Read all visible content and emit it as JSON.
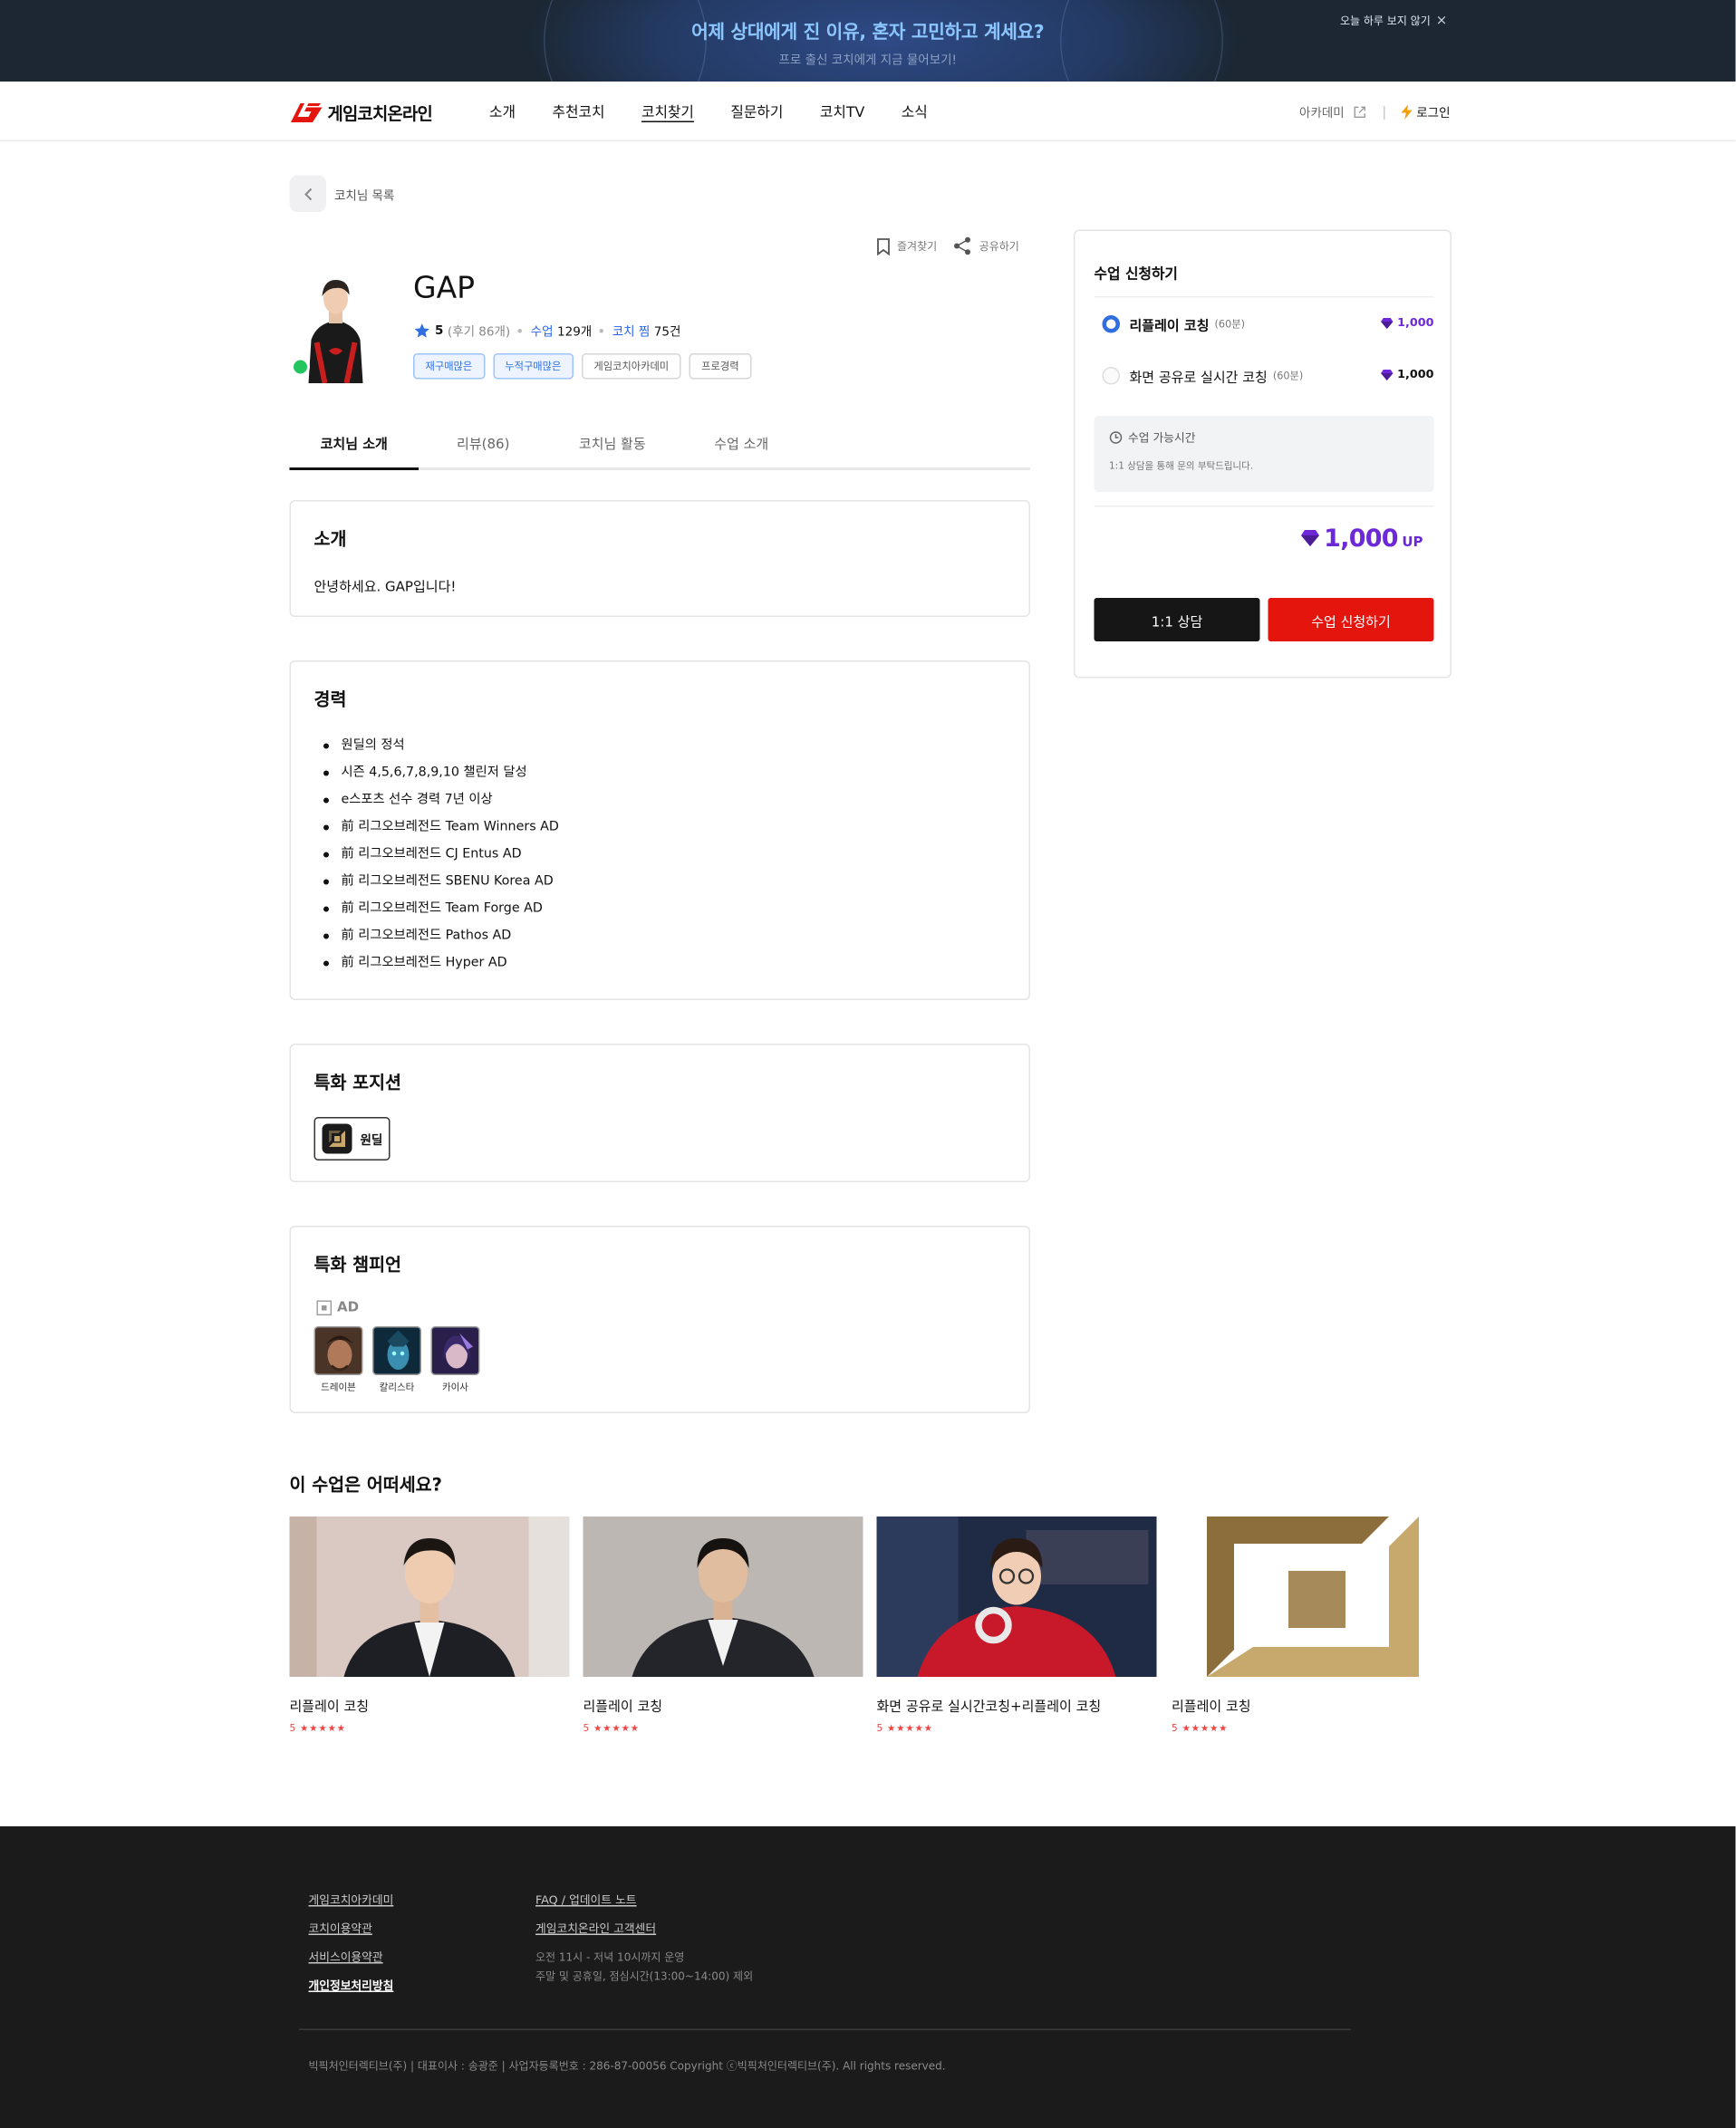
{
  "banner": {
    "title": "어제 상대에게 진 이유, 혼자 고민하고 계세요?",
    "subtitle": "프로 출신 코치에게 지금 물어보기!",
    "close_label": "오늘 하루 보지 않기",
    "close_icon": "×"
  },
  "header": {
    "logo_text": "게임코치온라인",
    "nav": [
      "소개",
      "추천코치",
      "코치찾기",
      "질문하기",
      "코치TV",
      "소식"
    ],
    "academy_label": "아카데미",
    "login_label": "로그인"
  },
  "breadcrumb": {
    "back_label": "코치님 목록"
  },
  "profile": {
    "bookmark_label": "즐겨찾기",
    "share_label": "공유하기",
    "name": "GAP",
    "rating": "5",
    "review_count_text": "(후기 86개)",
    "lessons_label": "수업",
    "lessons_value": "129개",
    "likes_label": "코치 찜",
    "likes_value": "75건",
    "tags": [
      {
        "label": "재구매많은",
        "style": "blue"
      },
      {
        "label": "누적구매많은",
        "style": "blue"
      },
      {
        "label": "게임코치아카데미",
        "style": "plain"
      },
      {
        "label": "프로경력",
        "style": "plain"
      }
    ]
  },
  "tabs": [
    "코치님 소개",
    "리뷰(86)",
    "코치님 활동",
    "수업 소개"
  ],
  "intro": {
    "title": "소개",
    "text": "안녕하세요. GAP입니다!"
  },
  "career": {
    "title": "경력",
    "items": [
      "원딜의 정석",
      "시즌 4,5,6,7,8,9,10 챌린저 달성",
      "e스포츠 선수 경력 7년 이상",
      "前 리그오브레전드 Team Winners AD",
      "前 리그오브레전드 CJ Entus AD",
      "前 리그오브레전드 SBENU Korea AD",
      "前 리그오브레전드 Team Forge AD",
      "前 리그오브레전드 Pathos AD",
      "前 리그오브레전드 Hyper AD"
    ]
  },
  "position": {
    "title": "특화 포지션",
    "chip": "원딜"
  },
  "champions": {
    "title": "특화 챔피언",
    "role": "AD",
    "list": [
      "드레이븐",
      "칼리스타",
      "카이사"
    ]
  },
  "side": {
    "title": "수업 신청하기",
    "options": [
      {
        "label": "리플레이 코칭",
        "duration": "(60분)",
        "price": "1,000",
        "selected": true
      },
      {
        "label": "화면 공유로 실시간 코칭",
        "duration": "(60분)",
        "price": "1,000",
        "selected": false
      }
    ],
    "avail_title": "수업 가능시간",
    "avail_desc": "1:1 상담을 통해 문의 부탁드립니다.",
    "total": "1,000",
    "total_unit": "UP",
    "consult_label": "1:1 상담",
    "apply_label": "수업 신청하기"
  },
  "recommend": {
    "title": "이 수업은 어떠세요?",
    "cards": [
      {
        "title": "리플레이 코칭",
        "rating": "5 ★★★★★"
      },
      {
        "title": "리플레이 코칭",
        "rating": "5 ★★★★★"
      },
      {
        "title": "화면 공유로 실시간코칭+리플레이 코칭",
        "rating": "5 ★★★★★"
      },
      {
        "title": "리플레이 코칭",
        "rating": "5 ★★★★★"
      }
    ]
  },
  "footer": {
    "col1": [
      "게임코치아카데미",
      "코치이용약관",
      "서비스이용약관",
      "개인정보처리방침"
    ],
    "col2": [
      "FAQ / 업데이트 노트",
      "게임코치온라인 고객센터"
    ],
    "hours_1": "오전 11시 - 저녁 10시까지 운영",
    "hours_2": "주말 및 공휴일, 점심시간(13:00~14:00) 제외",
    "copyright": "빅픽처인터렉티브(주)  |  대표이사 : 송광준  |  사업자등록번호 : 286-87-00056 Copyright ⓒ빅픽처인터렉티브(주). All rights reserved."
  },
  "colors": {
    "accent_blue": "#2f6fe0",
    "purple": "#6d28d9",
    "red": "#e3150d",
    "online": "#22c55e"
  }
}
